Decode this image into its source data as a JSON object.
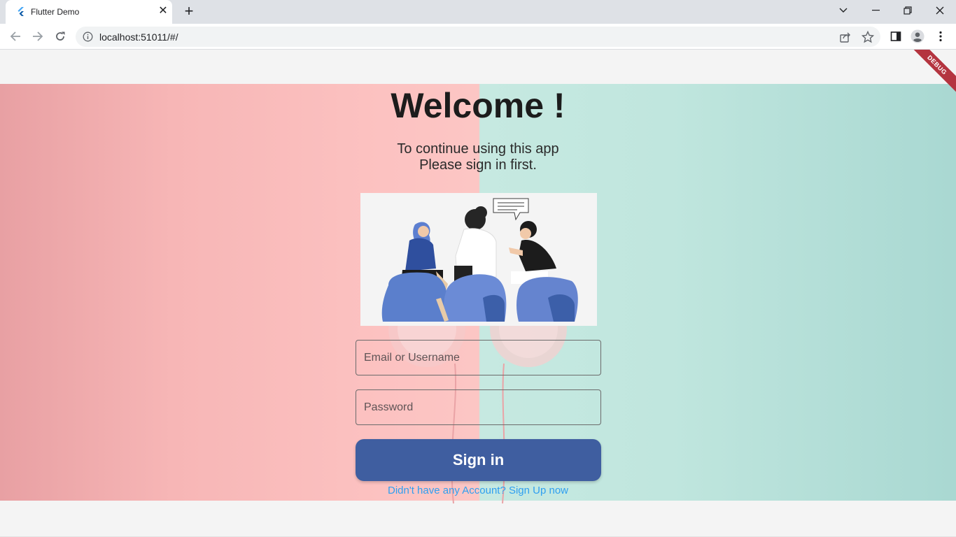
{
  "browser": {
    "tab_title": "Flutter Demo",
    "tab_close": "✕",
    "new_tab": "+",
    "url": "localhost:51011/#/"
  },
  "app": {
    "debug_banner": "DEBUG",
    "title": "Welcome !",
    "subtitle_line1": "To continue using this app",
    "subtitle_line2": "Please sign in first.",
    "email_placeholder": "Email or Username",
    "password_placeholder": "Password",
    "signin_label": "Sign in",
    "signup_link": "Didn't have any Account? Sign Up now"
  },
  "colors": {
    "accent_button": "#3f5ea0",
    "link": "#2f9ff0",
    "left_background": "#fcc2c1",
    "right_background": "#c0e6de"
  }
}
